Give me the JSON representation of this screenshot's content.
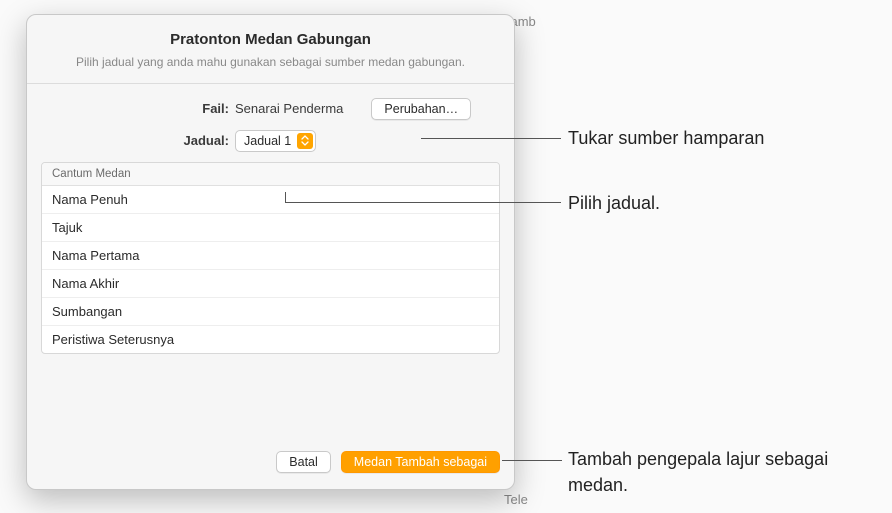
{
  "dialog": {
    "title": "Pratonton Medan Gabungan",
    "subtitle": "Pilih jadual yang anda mahu gunakan sebagai sumber medan gabungan.",
    "file_label": "Fail:",
    "file_value": "Senarai Penderma",
    "change_label": "Perubahan…",
    "table_label": "Jadual:",
    "table_value": "Jadual 1",
    "column_header": "Cantum Medan",
    "fields": [
      "Nama Penuh",
      "Tajuk",
      "Nama Pertama",
      "Nama Akhir",
      "Sumbangan",
      "Peristiwa Seterusnya"
    ],
    "cancel_label": "Batal",
    "add_label": "Medan Tambah sebagai"
  },
  "callouts": {
    "change": "Tukar sumber hamparan",
    "picktable": "Pilih jadual.",
    "add": "Tambah pengepala lajur sebagai medan."
  },
  "background": {
    "t1": "Tamb",
    "t2": "Tele"
  }
}
